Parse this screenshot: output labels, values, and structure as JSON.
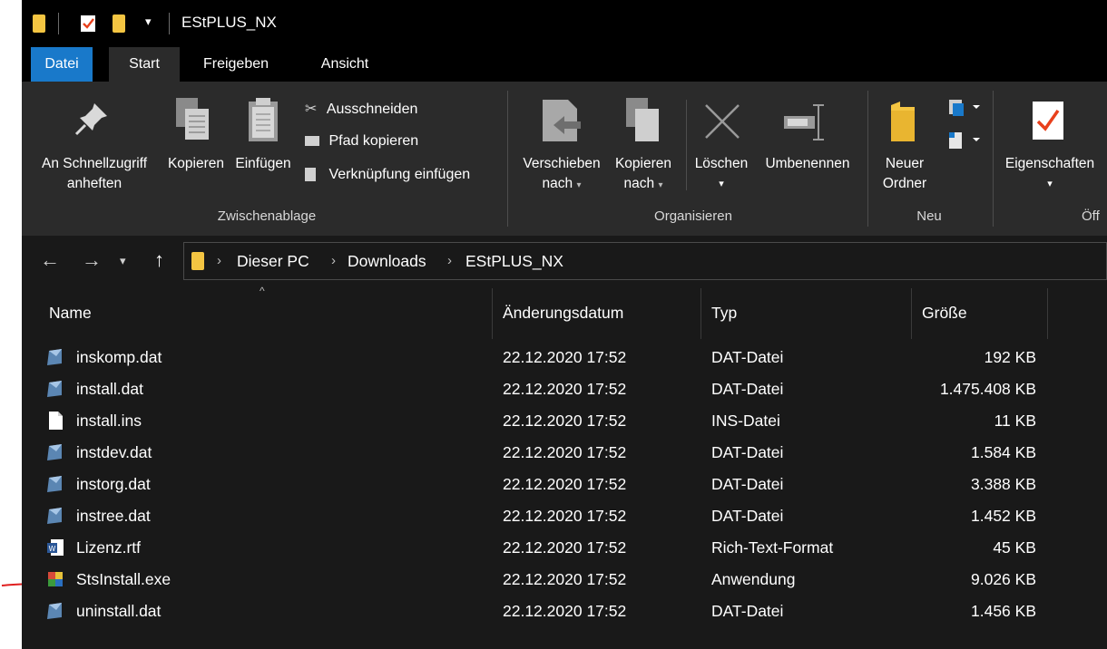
{
  "window": {
    "title": "EStPLUS_NX"
  },
  "tabs": [
    {
      "label": "Datei"
    },
    {
      "label": "Start"
    },
    {
      "label": "Freigeben"
    },
    {
      "label": "Ansicht"
    }
  ],
  "ribbon": {
    "pin": {
      "line1": "An Schnellzugriff",
      "line2": "anheften"
    },
    "copy": "Kopieren",
    "paste": "Einfügen",
    "cut": "Ausschneiden",
    "copy_path": "Pfad kopieren",
    "paste_shortcut": "Verknüpfung einfügen",
    "group_clipboard": "Zwischenablage",
    "move_to": {
      "line1": "Verschieben",
      "line2": "nach"
    },
    "copy_to": {
      "line1": "Kopieren",
      "line2": "nach"
    },
    "delete": "Löschen",
    "rename": "Umbenennen",
    "group_organize": "Organisieren",
    "new_folder": {
      "line1": "Neuer",
      "line2": "Ordner"
    },
    "group_new": "Neu",
    "properties": "Eigenschaften",
    "group_open_partial": "Öff"
  },
  "breadcrumb": [
    "Dieser PC",
    "Downloads",
    "EStPLUS_NX"
  ],
  "columns": {
    "name": "Name",
    "date": "Änderungsdatum",
    "type": "Typ",
    "size": "Größe"
  },
  "files": [
    {
      "name": "inskomp.dat",
      "date": "22.12.2020 17:52",
      "type": "DAT-Datei",
      "size": "192 KB",
      "icon": "dat-file-icon"
    },
    {
      "name": "install.dat",
      "date": "22.12.2020 17:52",
      "type": "DAT-Datei",
      "size": "1.475.408 KB",
      "icon": "dat-file-icon"
    },
    {
      "name": "install.ins",
      "date": "22.12.2020 17:52",
      "type": "INS-Datei",
      "size": "11 KB",
      "icon": "blank-file-icon"
    },
    {
      "name": "instdev.dat",
      "date": "22.12.2020 17:52",
      "type": "DAT-Datei",
      "size": "1.584 KB",
      "icon": "dat-file-icon"
    },
    {
      "name": "instorg.dat",
      "date": "22.12.2020 17:52",
      "type": "DAT-Datei",
      "size": "3.388 KB",
      "icon": "dat-file-icon"
    },
    {
      "name": "instree.dat",
      "date": "22.12.2020 17:52",
      "type": "DAT-Datei",
      "size": "1.452 KB",
      "icon": "dat-file-icon"
    },
    {
      "name": "Lizenz.rtf",
      "date": "22.12.2020 17:52",
      "type": "Rich-Text-Format",
      "size": "45 KB",
      "icon": "word-rtf-icon"
    },
    {
      "name": "StsInstall.exe",
      "date": "22.12.2020 17:52",
      "type": "Anwendung",
      "size": "9.026 KB",
      "icon": "installer-exe-icon"
    },
    {
      "name": "uninstall.dat",
      "date": "22.12.2020 17:52",
      "type": "DAT-Datei",
      "size": "1.456 KB",
      "icon": "dat-file-icon"
    }
  ],
  "colors": {
    "accent": "#1979ca",
    "folder": "#f4c542",
    "annotation_arrow": "#e02020"
  }
}
